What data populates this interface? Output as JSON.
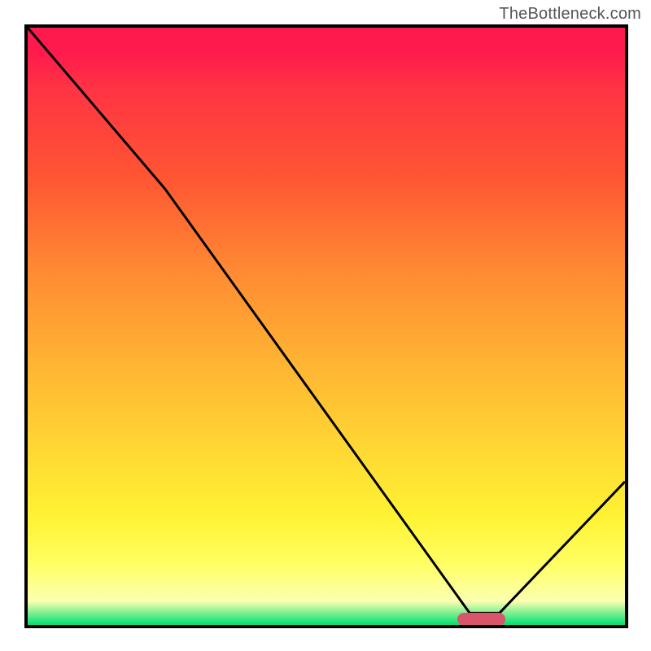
{
  "attribution": "TheBottleneck.com",
  "chart_data": {
    "type": "line",
    "title": "",
    "xlabel": "",
    "ylabel": "",
    "xlim": [
      0,
      100
    ],
    "ylim": [
      0,
      100
    ],
    "x": [
      0,
      23,
      74,
      79,
      100
    ],
    "values": [
      100,
      73,
      2,
      2,
      24
    ],
    "optimum_marker": {
      "x_start": 72,
      "x_end": 80,
      "y": 1
    },
    "background": {
      "type": "vertical_gradient",
      "stops": [
        {
          "pos": 0,
          "color": "#ff1a4d"
        },
        {
          "pos": 10,
          "color": "#ff3344"
        },
        {
          "pos": 25,
          "color": "#ff5533"
        },
        {
          "pos": 40,
          "color": "#ff8833"
        },
        {
          "pos": 55,
          "color": "#ffb133"
        },
        {
          "pos": 70,
          "color": "#ffd633"
        },
        {
          "pos": 82,
          "color": "#fff333"
        },
        {
          "pos": 90,
          "color": "#ffff66"
        },
        {
          "pos": 96,
          "color": "#fbffb0"
        },
        {
          "pos": 100,
          "color": "#00e070"
        }
      ]
    }
  }
}
